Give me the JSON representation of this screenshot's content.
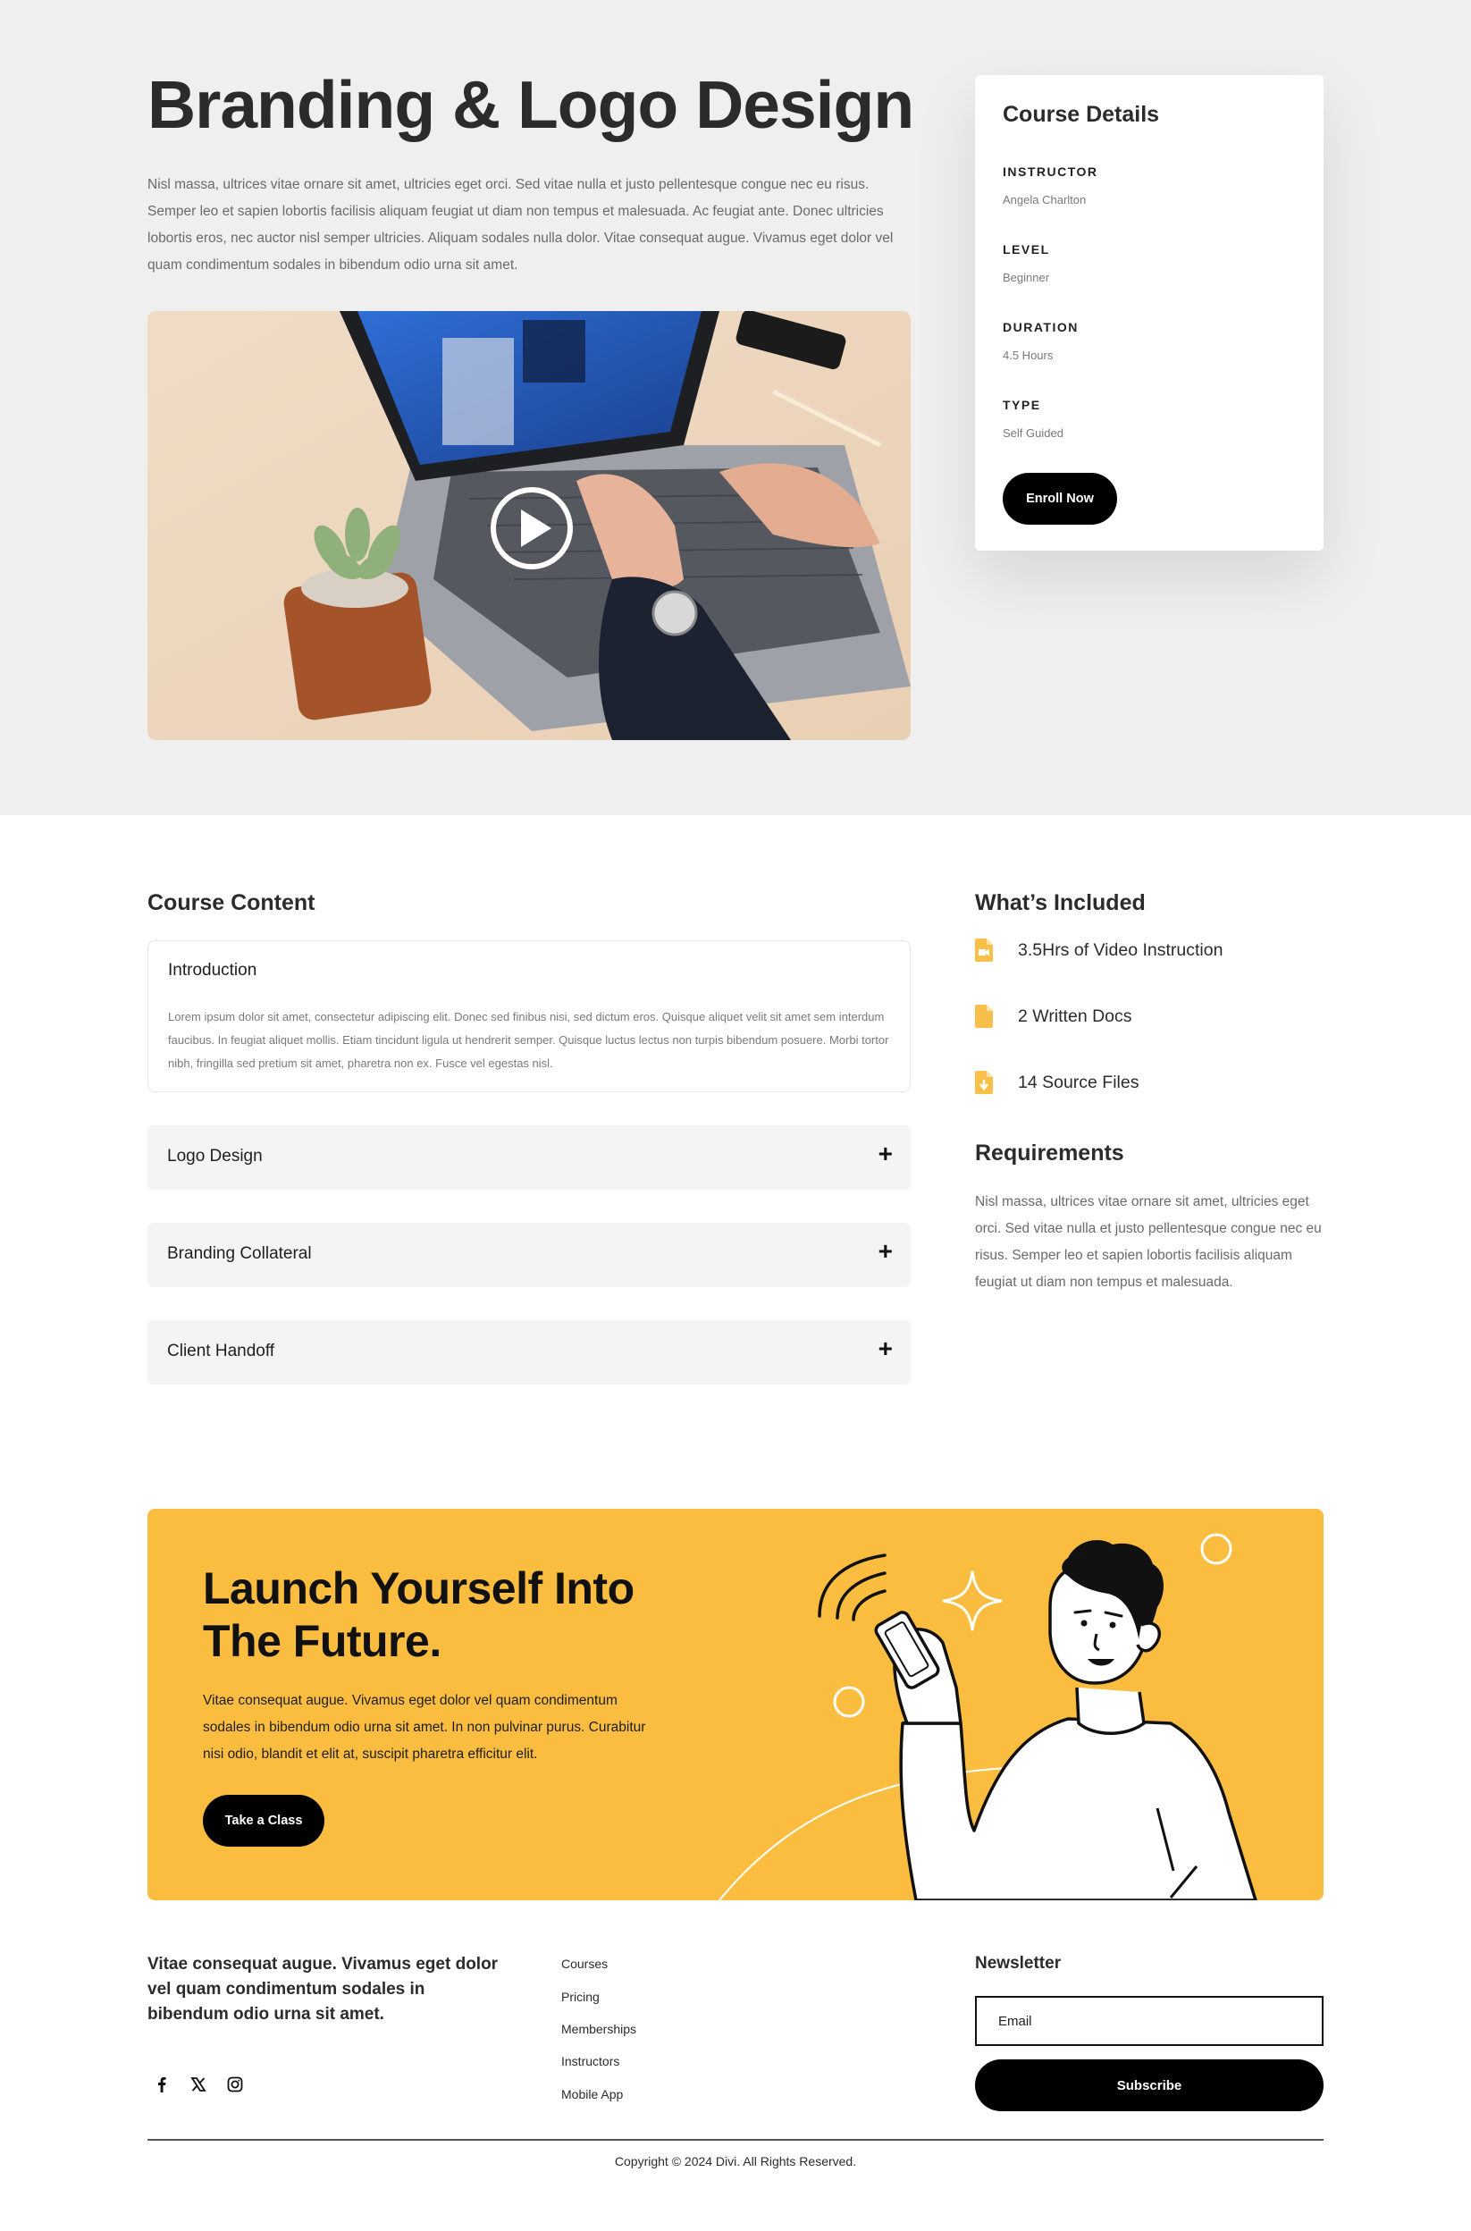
{
  "hero": {
    "title": "Branding & Logo Design",
    "description": "Nisl massa, ultrices vitae ornare sit amet, ultricies eget orci. Sed vitae nulla et justo pellentesque congue nec eu risus. Semper leo et sapien lobortis facilisis aliquam feugiat ut diam non tempus et malesuada. Ac feugiat ante. Donec ultricies lobortis eros, nec auctor nisl semper ultricies. Aliquam sodales nulla dolor. Vitae consequat augue. Vivamus eget dolor vel quam condimentum sodales in bibendum odio urna sit amet."
  },
  "course_details": {
    "title": "Course Details",
    "items": [
      {
        "label": "INSTRUCTOR",
        "value": "Angela Charlton"
      },
      {
        "label": "LEVEL",
        "value": "Beginner"
      },
      {
        "label": "DURATION",
        "value": "4.5 Hours"
      },
      {
        "label": "TYPE",
        "value": "Self Guided"
      }
    ],
    "enroll_label": "Enroll Now"
  },
  "course_content": {
    "heading": "Course Content",
    "intro": {
      "title": "Introduction",
      "body": "Lorem ipsum dolor sit amet, consectetur adipiscing elit. Donec sed finibus nisi, sed dictum eros. Quisque aliquet velit sit amet sem interdum faucibus. In feugiat aliquet mollis. Etiam tincidunt ligula ut hendrerit semper. Quisque luctus lectus non turpis bibendum posuere. Morbi tortor nibh, fringilla sed pretium sit amet, pharetra non ex. Fusce vel egestas nisl."
    },
    "accordions": [
      {
        "label": "Logo Design",
        "icon": "+"
      },
      {
        "label": "Branding Collateral",
        "icon": "+"
      },
      {
        "label": "Client Handoff",
        "icon": "+"
      }
    ]
  },
  "included": {
    "heading": "What’s Included",
    "accent": "#f8c04b",
    "items": [
      {
        "label": "3.5Hrs of Video Instruction",
        "icon": "video-file-icon"
      },
      {
        "label": "2 Written Docs",
        "icon": "document-icon"
      },
      {
        "label": "14 Source Files",
        "icon": "download-file-icon"
      }
    ]
  },
  "requirements": {
    "heading": "Requirements",
    "body": "Nisl massa, ultrices vitae ornare sit amet, ultricies eget orci. Sed vitae nulla et justo pellentesque congue nec eu risus. Semper leo et sapien lobortis facilisis aliquam feugiat ut diam non tempus et malesuada."
  },
  "cta": {
    "title": "Launch Yourself Into The Future.",
    "description": "Vitae consequat augue. Vivamus eget dolor vel quam condimentum sodales in bibendum odio urna sit amet. In non pulvinar purus. Curabitur nisi odio, blandit et elit at, suscipit pharetra efficitur elit.",
    "button_label": "Take a Class",
    "bg_color": "#fbbd40"
  },
  "footer": {
    "blurb": "Vitae consequat augue. Vivamus eget dolor vel quam condimentum sodales in bibendum odio urna sit amet.",
    "links": [
      "Courses",
      "Pricing",
      "Memberships",
      "Instructors",
      "Mobile App"
    ],
    "social": [
      "facebook-icon",
      "x-icon",
      "instagram-icon"
    ],
    "newsletter_heading": "Newsletter",
    "email_placeholder": "Email",
    "subscribe_label": "Subscribe",
    "copyright": "Copyright © 2024 Divi. All Rights Reserved."
  }
}
